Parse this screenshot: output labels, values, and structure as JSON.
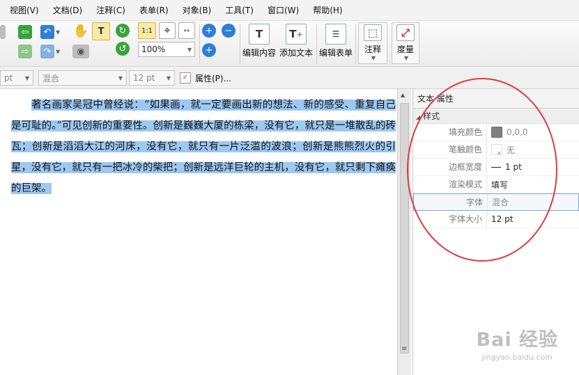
{
  "menu": [
    "视图(V)",
    "文档(D)",
    "注释(C)",
    "表单(R)",
    "对象(B)",
    "工具(T)",
    "窗口(W)",
    "帮助(H)"
  ],
  "toolbar": {
    "zoom_value": "100%",
    "edit_content_label": "编辑内容",
    "add_text_label": "添加文本",
    "edit_form_label": "编辑表单",
    "annotate_label": "注释",
    "measure_label": "度量",
    "fit_page_label": "1:1"
  },
  "formatbar": {
    "size_left": "pt",
    "font_value": "混合",
    "size_value": "12 pt",
    "properties_label": "属性(P)..."
  },
  "document": {
    "paragraph": "著名画家吴冠中曾经说：“如果画，就一定要画出新的想法、新的感受、重复自己是可耻的。”可见创新的重要性。创新是巍巍大厦的栋梁，没有它，就只是一堆散乱的砖瓦；创新是滔滔大江的河床，没有它，就只有一片泛滥的波浪；创新是熊熊烈火的引星，没有它，就只有一把冰冷的柴把；创新是远洋巨轮的主机，没有它，就只剩下瘫痪的巨架。"
  },
  "panel": {
    "title": "文本 属性",
    "section": "样式",
    "rows": [
      {
        "label": "填充颜色",
        "value": "0,0,0"
      },
      {
        "label": "笔触颜色",
        "value": "无"
      },
      {
        "label": "边框宽度",
        "value": "1 pt"
      },
      {
        "label": "渲染模式",
        "value": "填写"
      },
      {
        "label": "字体",
        "value": "混合"
      },
      {
        "label": "字体大小",
        "value": "12 pt"
      }
    ]
  },
  "watermark": {
    "main": "Bai 经验",
    "sub": "jingyan.baidu.com"
  },
  "colors": {
    "highlight": "#9cc8f2",
    "annotation": "#e23a3a",
    "fill_swatch": "#808080"
  }
}
